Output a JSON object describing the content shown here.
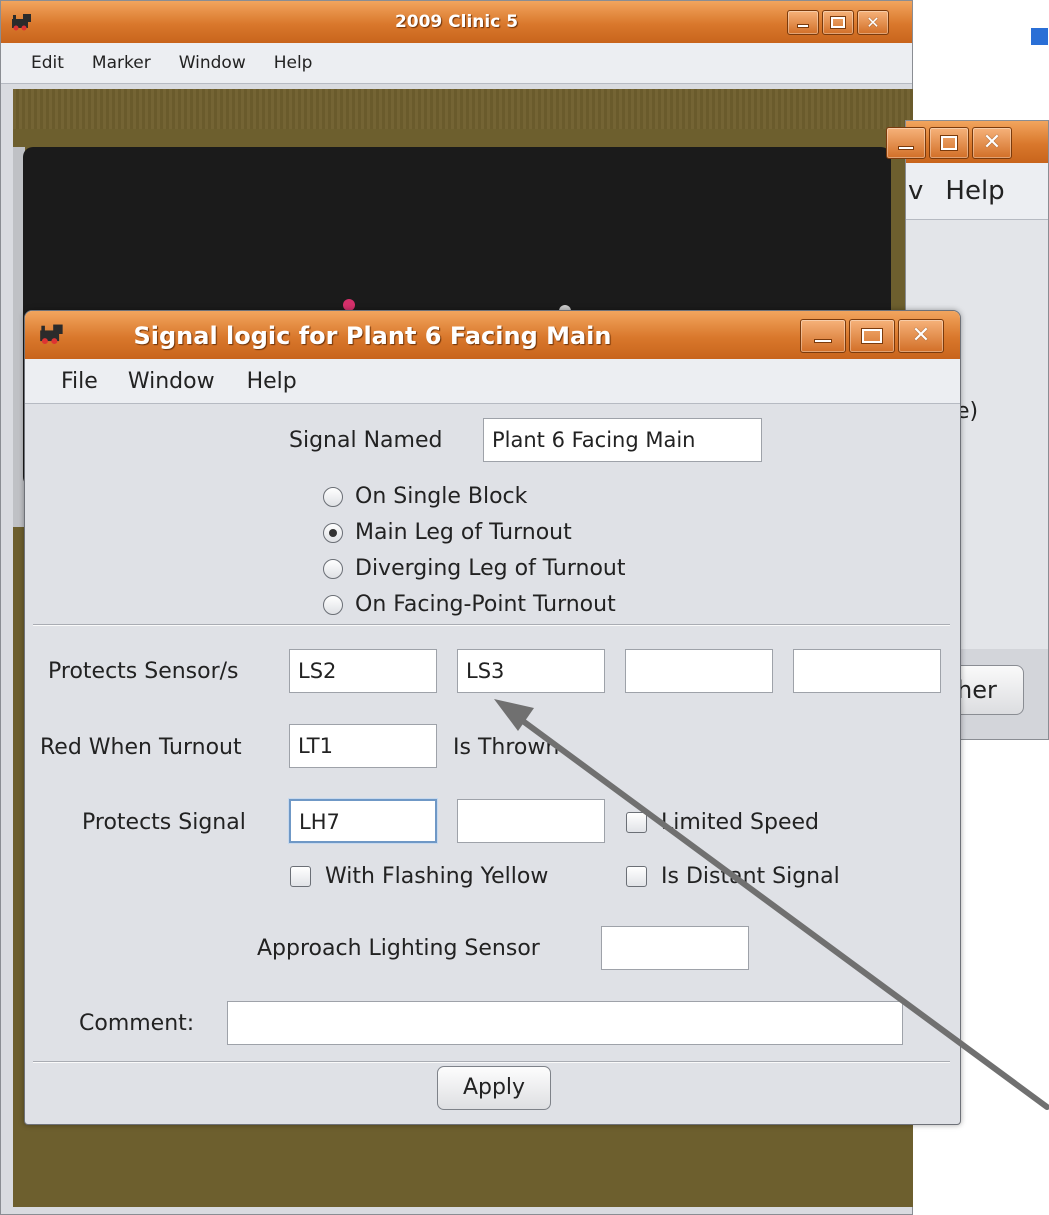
{
  "back_window": {
    "title": "2009 Clinic 5",
    "menu": [
      "Edit",
      "Marker",
      "Window",
      "Help"
    ]
  },
  "middle_window": {
    "menu_fragment_a": "v",
    "menu_fragment_b": "Help",
    "text_fragment": "e)",
    "button_fragment": "her"
  },
  "dialog": {
    "title": "Signal logic for Plant 6 Facing Main",
    "menu": [
      "File",
      "Window",
      "Help"
    ],
    "signal_named_label": "Signal Named",
    "signal_named_value": "Plant 6 Facing Main",
    "radio_options": [
      {
        "label": "On Single Block",
        "selected": false
      },
      {
        "label": "Main Leg of Turnout",
        "selected": true
      },
      {
        "label": "Diverging Leg of Turnout",
        "selected": false
      },
      {
        "label": "On Facing-Point Turnout",
        "selected": false
      }
    ],
    "protects_sensors_label": "Protects Sensor/s",
    "protects_sensors": [
      "LS2",
      "LS3",
      "",
      ""
    ],
    "red_when_turnout_label": "Red When Turnout",
    "red_when_turnout_value": "LT1",
    "is_thrown_label": "Is Thrown",
    "protects_signal_label": "Protects Signal",
    "protects_signal_values": [
      "LH7",
      ""
    ],
    "limited_speed_label": "Limited Speed",
    "limited_speed_checked": false,
    "with_flashing_yellow_label": "With Flashing Yellow",
    "with_flashing_yellow_checked": false,
    "is_distant_signal_label": "Is Distant Signal",
    "is_distant_signal_checked": false,
    "approach_lighting_label": "Approach Lighting Sensor",
    "approach_lighting_value": "",
    "comment_label": "Comment:",
    "comment_value": "",
    "apply_label": "Apply"
  },
  "colors": {
    "title_bar": "#d9782c",
    "layout_background": "#6d5f2e",
    "arrow": "#707070",
    "accent_square": "#2a6fd6"
  }
}
